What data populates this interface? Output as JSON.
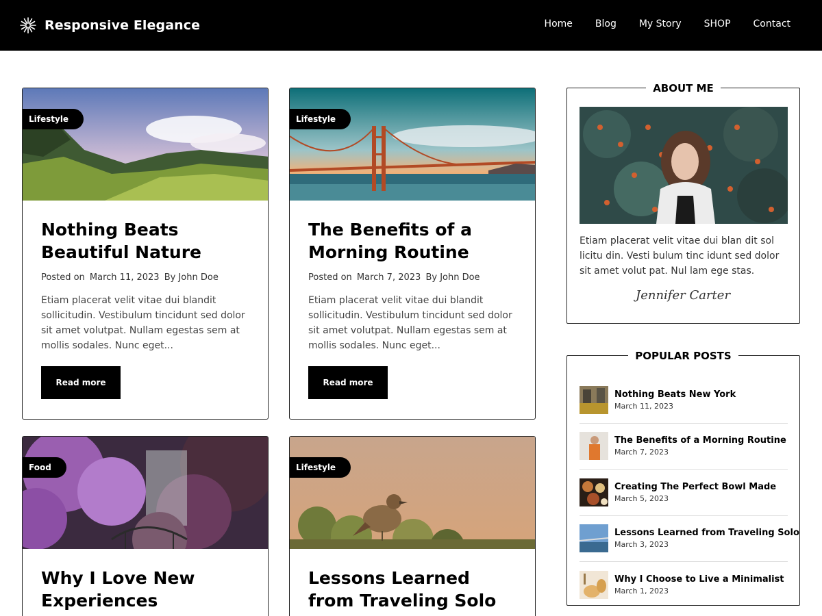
{
  "site": {
    "title": "Responsive Elegance"
  },
  "nav": [
    {
      "label": "Home"
    },
    {
      "label": "Blog"
    },
    {
      "label": "My Story"
    },
    {
      "label": "SHOP"
    },
    {
      "label": "Contact"
    }
  ],
  "posts": [
    {
      "category": "Lifestyle",
      "title": "Nothing Beats Beautiful Nature",
      "posted_on": "Posted on",
      "date": "March 11, 2023",
      "author": "By John Doe",
      "excerpt": "Etiam placerat velit vitae dui blandit sollicitudin. Vestibulum tincidunt sed dolor sit amet volutpat. Nullam egestas sem at mollis sodales. Nunc eget...",
      "read_more": "Read more"
    },
    {
      "category": "Lifestyle",
      "title": "The Benefits of a Morning Routine",
      "posted_on": "Posted on",
      "date": "March 7, 2023",
      "author": "By John Doe",
      "excerpt": "Etiam placerat velit vitae dui blandit sollicitudin. Vestibulum tincidunt sed dolor sit amet volutpat. Nullam egestas sem at mollis sodales. Nunc eget...",
      "read_more": "Read more"
    },
    {
      "category": "Food",
      "title": "Why I Love New Experiences"
    },
    {
      "category": "Lifestyle",
      "title": "Lessons Learned from Traveling Solo"
    }
  ],
  "about": {
    "heading": "ABOUT ME",
    "text": "Etiam placerat velit vitae dui blan dit sol licitu din. Vesti bulum tinc idunt sed dolor sit amet volut pat. Nul lam ege stas.",
    "signature": "Jennifer Carter"
  },
  "popular": {
    "heading": "POPULAR POSTS",
    "items": [
      {
        "title": "Nothing Beats New York",
        "date": "March 11, 2023"
      },
      {
        "title": "The Benefits of a Morning Routine",
        "date": "March 7, 2023"
      },
      {
        "title": "Creating The Perfect Bowl Made",
        "date": "March 5, 2023"
      },
      {
        "title": "Lessons Learned from Traveling Solo",
        "date": "March 3, 2023"
      },
      {
        "title": "Why I Choose to Live a Minimalist",
        "date": "March 1, 2023"
      }
    ]
  },
  "colors": {
    "header_bg": "#000000",
    "accent": "#000000",
    "text": "#333333"
  }
}
